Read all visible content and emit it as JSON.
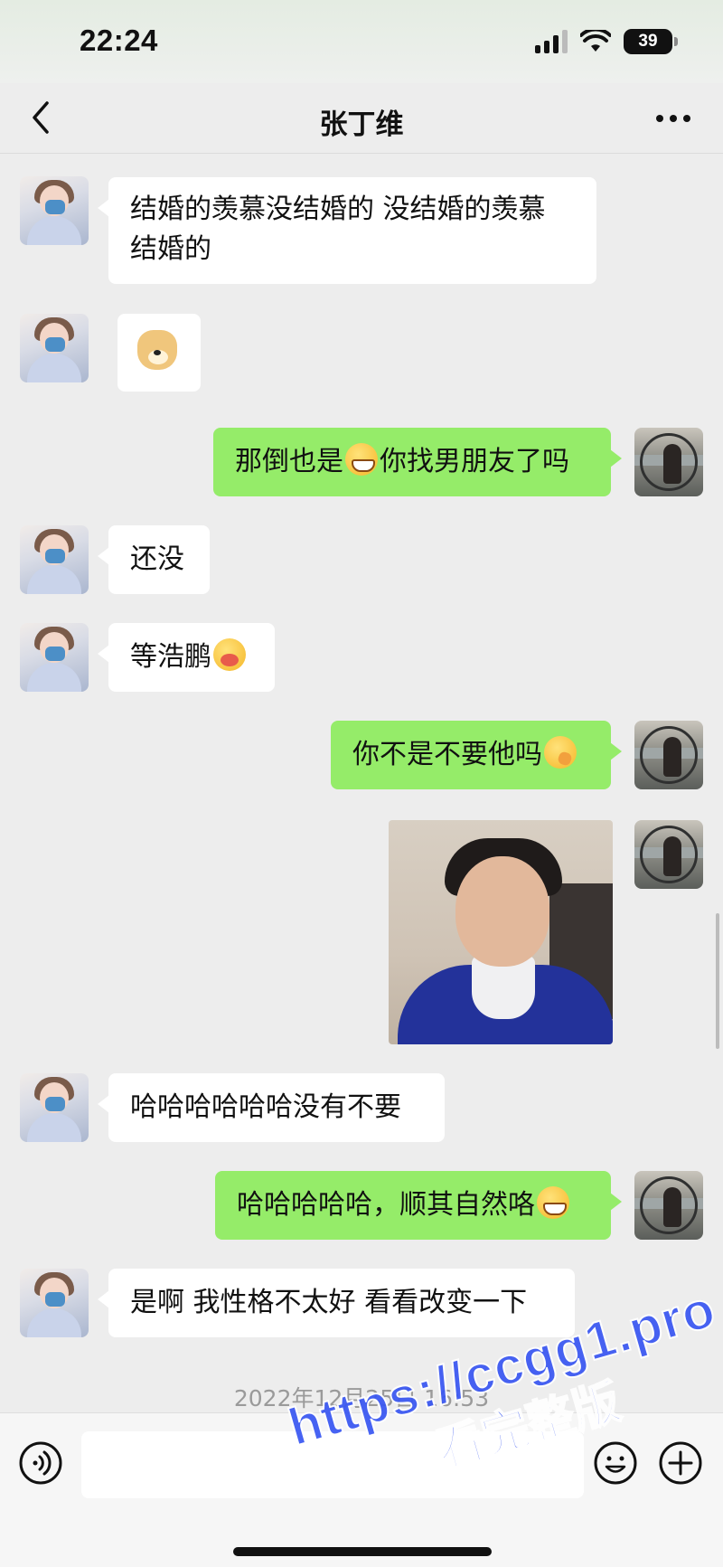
{
  "status_bar": {
    "time": "22:24",
    "battery": "39"
  },
  "nav": {
    "title": "张丁维"
  },
  "messages": [
    {
      "side": "left",
      "text": "结婚的羡慕没结婚的 没结婚的羡慕",
      "text_line2": "结婚的"
    },
    {
      "side": "left",
      "type": "sticker",
      "sticker": "doge-sticker"
    },
    {
      "side": "right",
      "text_before": "那倒也是",
      "emoji": "grin-emoji",
      "text_after": "你找男朋友了吗"
    },
    {
      "side": "left",
      "text": "还没"
    },
    {
      "side": "left",
      "text_before": "等浩鹏",
      "emoji": "facepalm-emoji",
      "text_after": ""
    },
    {
      "side": "right",
      "text_before": "你不是不要他吗",
      "emoji": "shy-emoji",
      "text_after": ""
    },
    {
      "side": "right",
      "type": "image",
      "image": "photo-of-young-man"
    },
    {
      "side": "left",
      "text": "哈哈哈哈哈哈没有不要"
    },
    {
      "side": "right",
      "text_before": "哈哈哈哈哈，顺其自然咯",
      "emoji": "grin-emoji",
      "text_after": ""
    },
    {
      "side": "left",
      "text": "是啊 我性格不太好 看看改变一下"
    }
  ],
  "timestamp": "2022年12月25日 16:53",
  "input": {
    "value": "",
    "placeholder": ""
  },
  "watermark": {
    "url": "https://ccgg1.pro",
    "tag": "看完整版"
  },
  "colors": {
    "background": "#ededed",
    "sent_bubble": "#95ec69",
    "received_bubble": "#ffffff",
    "watermark": "#3856f2"
  }
}
